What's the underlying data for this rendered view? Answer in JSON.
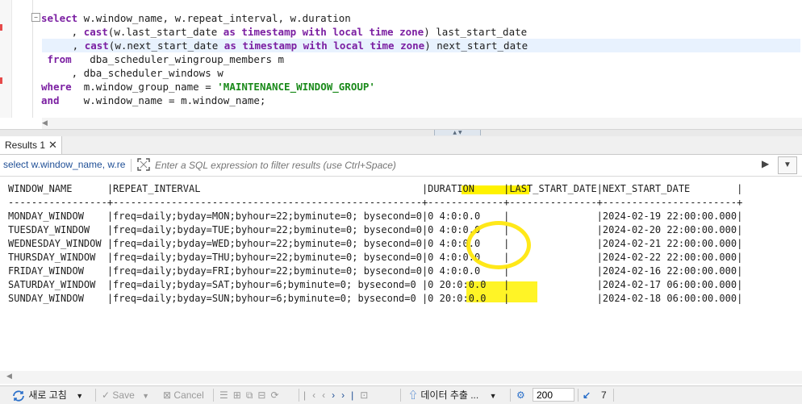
{
  "editor": {
    "lines": [
      {
        "parts": [
          {
            "t": "select",
            "c": "kw"
          },
          {
            "t": " w.window_name, w.repeat_interval, w.duration",
            "c": ""
          }
        ]
      },
      {
        "parts": [
          {
            "t": "     , ",
            "c": ""
          },
          {
            "t": "cast",
            "c": "fn"
          },
          {
            "t": "(w.last_start_date ",
            "c": ""
          },
          {
            "t": "as",
            "c": "kw"
          },
          {
            "t": " ",
            "c": ""
          },
          {
            "t": "timestamp",
            "c": "kw"
          },
          {
            "t": " ",
            "c": ""
          },
          {
            "t": "with",
            "c": "kw"
          },
          {
            "t": " ",
            "c": ""
          },
          {
            "t": "local",
            "c": "kw"
          },
          {
            "t": " ",
            "c": ""
          },
          {
            "t": "time",
            "c": "kw"
          },
          {
            "t": " ",
            "c": ""
          },
          {
            "t": "zone",
            "c": "kw"
          },
          {
            "t": ") last_start_date",
            "c": ""
          }
        ]
      },
      {
        "parts": [
          {
            "t": "     , ",
            "c": ""
          },
          {
            "t": "cast",
            "c": "fn"
          },
          {
            "t": "(w.next_start_date ",
            "c": ""
          },
          {
            "t": "as",
            "c": "kw"
          },
          {
            "t": " ",
            "c": ""
          },
          {
            "t": "timestamp",
            "c": "kw"
          },
          {
            "t": " ",
            "c": ""
          },
          {
            "t": "with",
            "c": "kw"
          },
          {
            "t": " ",
            "c": ""
          },
          {
            "t": "local",
            "c": "kw"
          },
          {
            "t": " ",
            "c": ""
          },
          {
            "t": "time",
            "c": "kw"
          },
          {
            "t": " ",
            "c": ""
          },
          {
            "t": "zone",
            "c": "kw"
          },
          {
            "t": ") next_start_date",
            "c": ""
          }
        ]
      },
      {
        "parts": [
          {
            "t": " from",
            "c": "kw"
          },
          {
            "t": "   dba_scheduler_wingroup_members m",
            "c": ""
          }
        ]
      },
      {
        "parts": [
          {
            "t": "     , dba_scheduler_windows w",
            "c": ""
          }
        ]
      },
      {
        "parts": [
          {
            "t": "where",
            "c": "kw"
          },
          {
            "t": "  m.window_group_name = ",
            "c": ""
          },
          {
            "t": "'MAINTENANCE_WINDOW_GROUP'",
            "c": "str"
          }
        ]
      },
      {
        "parts": [
          {
            "t": "and",
            "c": "kw"
          },
          {
            "t": "    w.window_name = m.window_name;",
            "c": ""
          }
        ]
      }
    ]
  },
  "tabs": {
    "results_label": "Results 1",
    "close_glyph": "✕"
  },
  "filter": {
    "query_text": "select w.window_name, w.re",
    "placeholder": "Enter a SQL expression to filter results (use Ctrl+Space)"
  },
  "results": {
    "header": "WINDOW_NAME      |REPEAT_INTERVAL                                      |DURATION     |LAST_START_DATE|NEXT_START_DATE        |",
    "divider": "-----------------+-----------------------------------------------------+-------------+---------------+-----------------------+",
    "rows": [
      "MONDAY_WINDOW    |freq=daily;byday=MON;byhour=22;byminute=0; bysecond=0|0 4:0:0.0    |               |2024-02-19 22:00:00.000|",
      "TUESDAY_WINDOW   |freq=daily;byday=TUE;byhour=22;byminute=0; bysecond=0|0 4:0:0.0    |               |2024-02-20 22:00:00.000|",
      "WEDNESDAY_WINDOW |freq=daily;byday=WED;byhour=22;byminute=0; bysecond=0|0 4:0:0.0    |               |2024-02-21 22:00:00.000|",
      "THURSDAY_WINDOW  |freq=daily;byday=THU;byhour=22;byminute=0; bysecond=0|0 4:0:0.0    |               |2024-02-22 22:00:00.000|",
      "FRIDAY_WINDOW    |freq=daily;byday=FRI;byhour=22;byminute=0; bysecond=0|0 4:0:0.0    |               |2024-02-16 22:00:00.000|",
      "SATURDAY_WINDOW  |freq=daily;byday=SAT;byhour=6;byminute=0; bysecond=0 |0 20:0:0.0   |               |2024-02-17 06:00:00.000|",
      "SUNDAY_WINDOW    |freq=daily;byday=SUN;byhour=6;byminute=0; bysecond=0 |0 20:0:0.0   |               |2024-02-18 06:00:00.000|"
    ],
    "highlight_color": "#fff200"
  },
  "toolbar": {
    "refresh_label": "새로 고침",
    "save_label": "Save",
    "cancel_label": "Cancel",
    "export_label": "데이터 추출 ...",
    "fetch_size": "200",
    "row_count": "7"
  },
  "colors": {
    "keyword": "#7b1fa2",
    "string": "#1a8a1a",
    "accent": "#1f6fd0"
  }
}
